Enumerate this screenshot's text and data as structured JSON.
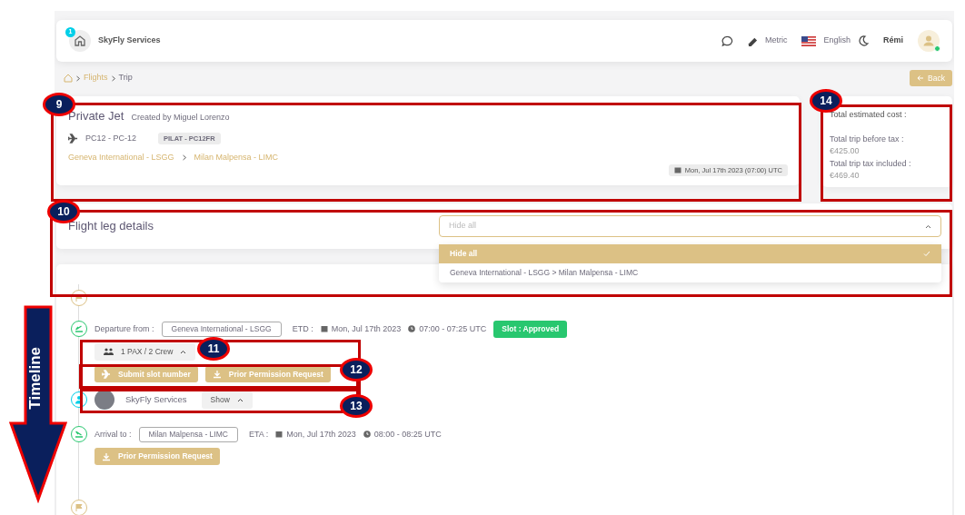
{
  "navbar": {
    "brand": "SkyFly Services",
    "notification_count": "1",
    "units": "Metric",
    "language": "English",
    "user": "Rémi",
    "user_online": true
  },
  "breadcrumb": [
    {
      "label": "Flights",
      "link": true
    },
    {
      "label": "Trip",
      "link": false
    }
  ],
  "back_button": "Back",
  "trip": {
    "title": "Private Jet",
    "created_by": "Created by Miguel Lorenzo",
    "aircraft": "PC12 - PC-12",
    "registration": "PILAT - PC12FR",
    "from": "Geneva International - LSGG",
    "to": "Milan Malpensa - LIMC",
    "date": "Mon, Jul 17th 2023 (07:00) UTC"
  },
  "cost": {
    "title": "Total estimated cost :",
    "lines": [
      {
        "label": "Total trip before tax :",
        "value": "€425.00"
      },
      {
        "label": "Total trip tax included :",
        "value": "€469.40"
      }
    ]
  },
  "flight_leg": {
    "title": "Flight leg details",
    "select": {
      "placeholder": "Hide all",
      "expanded": true,
      "options": [
        {
          "label": "Hide all",
          "selected": true
        },
        {
          "label": "Geneva International - LSGG > Milan Malpensa - LIMC",
          "selected": false
        }
      ]
    }
  },
  "timeline": [
    {
      "kind": "start_flag"
    },
    {
      "kind": "departure",
      "label": "Departure from :",
      "airport": "Geneva International - LSGG",
      "time_label": "ETD :",
      "date": "Mon, Jul 17th 2023",
      "time": "07:00 - 07:25 UTC",
      "slot": "Slot : Approved"
    },
    {
      "kind": "pax",
      "text": "1 PAX  /  2 Crew",
      "expanded": true
    },
    {
      "kind": "actions",
      "buttons": [
        {
          "kind": "slot",
          "label": "Submit slot number"
        },
        {
          "kind": "permission",
          "label": "Prior Permission Request"
        }
      ]
    },
    {
      "kind": "handler",
      "name": "SkyFly Services",
      "toggle": "Show",
      "expanded": true
    },
    {
      "kind": "arrival",
      "label": "Arrival to :",
      "airport": "Milan Malpensa - LIMC",
      "time_label": "ETA :",
      "date": "Mon, Jul 17th 2023",
      "time": "08:00 - 08:25 UTC"
    },
    {
      "kind": "actions",
      "buttons": [
        {
          "kind": "permission",
          "label": "Prior Permission Request"
        }
      ]
    },
    {
      "kind": "end_flag"
    }
  ],
  "annotations": [
    {
      "number": "9"
    },
    {
      "number": "10"
    },
    {
      "number": "11"
    },
    {
      "number": "12"
    },
    {
      "number": "13"
    },
    {
      "number": "14"
    }
  ],
  "timeline_arrow": {
    "label": "Timeline"
  }
}
